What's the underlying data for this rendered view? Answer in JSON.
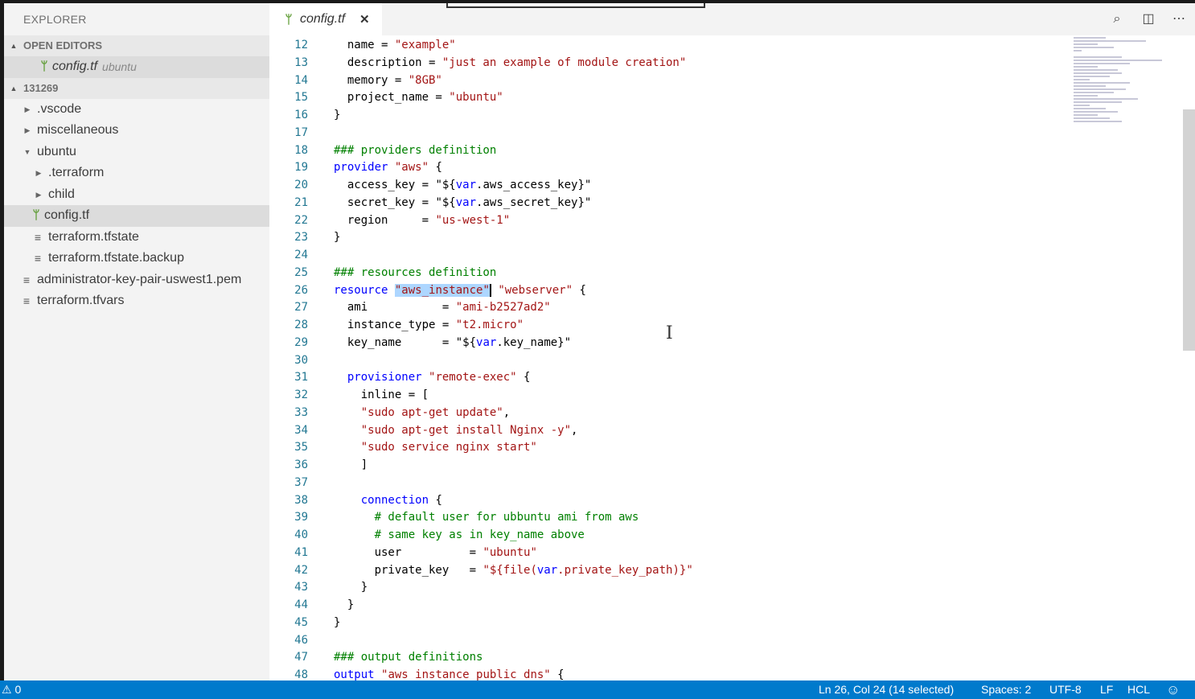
{
  "sidebar": {
    "title": "EXPLORER",
    "open_editors": {
      "header": "OPEN EDITORS",
      "items": [
        {
          "name": "config.tf",
          "desc": "ubuntu"
        }
      ]
    },
    "workspace": {
      "header": "131269",
      "tree": [
        {
          "name": ".vscode"
        },
        {
          "name": "miscellaneous"
        },
        {
          "name": "ubuntu"
        },
        {
          "name": ".terraform"
        },
        {
          "name": "child"
        },
        {
          "name": "config.tf"
        },
        {
          "name": "terraform.tfstate"
        },
        {
          "name": "terraform.tfstate.backup"
        },
        {
          "name": "administrator-key-pair-uswest1.pem"
        },
        {
          "name": "terraform.tfvars"
        }
      ]
    }
  },
  "editor": {
    "tab": {
      "label": "config.tf",
      "close": "✕"
    },
    "line_numbers": [
      "12",
      "13",
      "14",
      "15",
      "16",
      "17",
      "18",
      "19",
      "20",
      "21",
      "22",
      "23",
      "24",
      "25",
      "26",
      "27",
      "28",
      "29",
      "30",
      "31",
      "32",
      "33",
      "34",
      "35",
      "36",
      "37",
      "38",
      "39",
      "40",
      "41",
      "42",
      "43",
      "44",
      "45",
      "46",
      "47",
      "48"
    ],
    "code": {
      "l12": [
        "  name = ",
        "\"example\""
      ],
      "l13": [
        "  description = ",
        "\"just an example of module creation\""
      ],
      "l14": [
        "  memory = ",
        "\"8GB\""
      ],
      "l15": [
        "  project_name = ",
        "\"ubuntu\""
      ],
      "l16": "}",
      "l18": "### providers definition",
      "l19": [
        "provider",
        " ",
        "\"aws\"",
        " {"
      ],
      "l20": [
        "  access_key = ",
        "\"${",
        "var",
        ".aws_access_key}\""
      ],
      "l21": [
        "  secret_key = ",
        "\"${",
        "var",
        ".aws_secret_key}\""
      ],
      "l22": [
        "  region     = ",
        "\"us-west-1\""
      ],
      "l23": "}",
      "l25": "### resources definition",
      "l26": [
        "resource",
        " ",
        "\"aws_instance\"",
        " ",
        "\"webserver\"",
        " {"
      ],
      "l27": [
        "  ami           = ",
        "\"ami-b2527ad2\""
      ],
      "l28": [
        "  instance_type = ",
        "\"t2.micro\""
      ],
      "l29": [
        "  key_name      = ",
        "\"${",
        "var",
        ".key_name}\""
      ],
      "l31": [
        "  ",
        "provisioner",
        " ",
        "\"remote-exec\"",
        " {"
      ],
      "l32": "    inline = [",
      "l33": [
        "    ",
        "\"sudo apt-get update\"",
        ","
      ],
      "l34": [
        "    ",
        "\"sudo apt-get install Nginx -y\"",
        ","
      ],
      "l35": [
        "    ",
        "\"sudo service nginx start\""
      ],
      "l36": "    ]",
      "l38": [
        "    ",
        "connection",
        " {"
      ],
      "l39": "      # default user for ubbuntu ami from aws",
      "l40": "      # same key as in key_name above",
      "l41": [
        "      user          = ",
        "\"ubuntu\""
      ],
      "l42": [
        "      private_key   = ",
        "\"${file(",
        "var",
        ".private_key_path)}\""
      ],
      "l43": "    }",
      "l44": "  }",
      "l45": "}",
      "l47": "### output definitions",
      "l48": [
        "output",
        " ",
        "\"aws_instance_public_dns\"",
        " {"
      ]
    }
  },
  "statusbar": {
    "problems": "⚠ 0",
    "position": "Ln 26, Col 24 (14 selected)",
    "spaces": "Spaces: 2",
    "encoding": "UTF-8",
    "eol": "LF",
    "language": "HCL",
    "feedback": "☺"
  },
  "colors": {
    "statusbar": "#007acc",
    "keyword": "#0000ff",
    "string": "#a31515",
    "comment": "#008000",
    "line_number": "#237893",
    "selection": "#add6ff"
  }
}
